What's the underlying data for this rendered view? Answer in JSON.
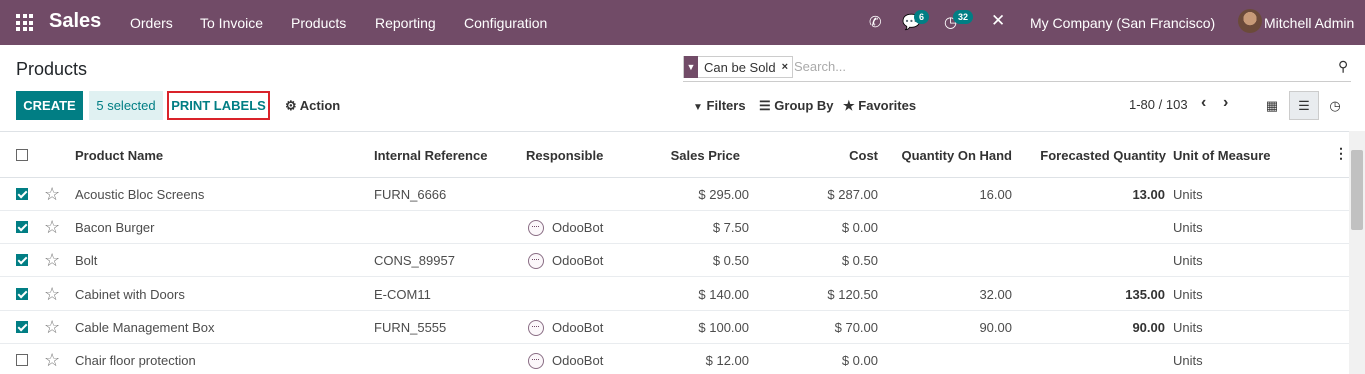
{
  "navbar": {
    "app_name": "Sales",
    "menu": [
      "Orders",
      "To Invoice",
      "Products",
      "Reporting",
      "Configuration"
    ],
    "messages_count": "6",
    "activities_count": "32",
    "company": "My Company (San Francisco)",
    "user": "Mitchell Admin",
    "accent": "#714b67"
  },
  "control": {
    "title": "Products",
    "facet_label": "Can be Sold",
    "search_placeholder": "Search...",
    "create_label": "CREATE",
    "selected_label": "5 selected",
    "print_labels": "PRINT LABELS",
    "action_label": "Action",
    "filters_label": "Filters",
    "groupby_label": "Group By",
    "favorites_label": "Favorites",
    "pager": "1-80 / 103",
    "teal": "#017e84"
  },
  "table": {
    "headers": {
      "name": "Product Name",
      "ref": "Internal Reference",
      "responsible": "Responsible",
      "price": "Sales Price",
      "cost": "Cost",
      "qty": "Quantity On Hand",
      "forecast": "Forecasted Quantity",
      "uom": "Unit of Measure"
    },
    "rows": [
      {
        "checked": true,
        "name": "Acoustic Bloc Screens",
        "ref": "FURN_6666",
        "responsible": "",
        "price": "$ 295.00",
        "cost": "$ 287.00",
        "qty": "16.00",
        "forecast": "13.00",
        "uom": "Units"
      },
      {
        "checked": true,
        "name": "Bacon Burger",
        "ref": "",
        "responsible": "OdooBot",
        "price": "$ 7.50",
        "cost": "$ 0.00",
        "qty": "",
        "forecast": "",
        "uom": "Units"
      },
      {
        "checked": true,
        "name": "Bolt",
        "ref": "CONS_89957",
        "responsible": "OdooBot",
        "price": "$ 0.50",
        "cost": "$ 0.50",
        "qty": "",
        "forecast": "",
        "uom": "Units"
      },
      {
        "checked": true,
        "name": "Cabinet with Doors",
        "ref": "E-COM11",
        "responsible": "",
        "price": "$ 140.00",
        "cost": "$ 120.50",
        "qty": "32.00",
        "forecast": "135.00",
        "uom": "Units"
      },
      {
        "checked": true,
        "name": "Cable Management Box",
        "ref": "FURN_5555",
        "responsible": "OdooBot",
        "price": "$ 100.00",
        "cost": "$ 70.00",
        "qty": "90.00",
        "forecast": "90.00",
        "uom": "Units"
      },
      {
        "checked": false,
        "name": "Chair floor protection",
        "ref": "",
        "responsible": "OdooBot",
        "price": "$ 12.00",
        "cost": "$ 0.00",
        "qty": "",
        "forecast": "",
        "uom": "Units"
      }
    ]
  }
}
